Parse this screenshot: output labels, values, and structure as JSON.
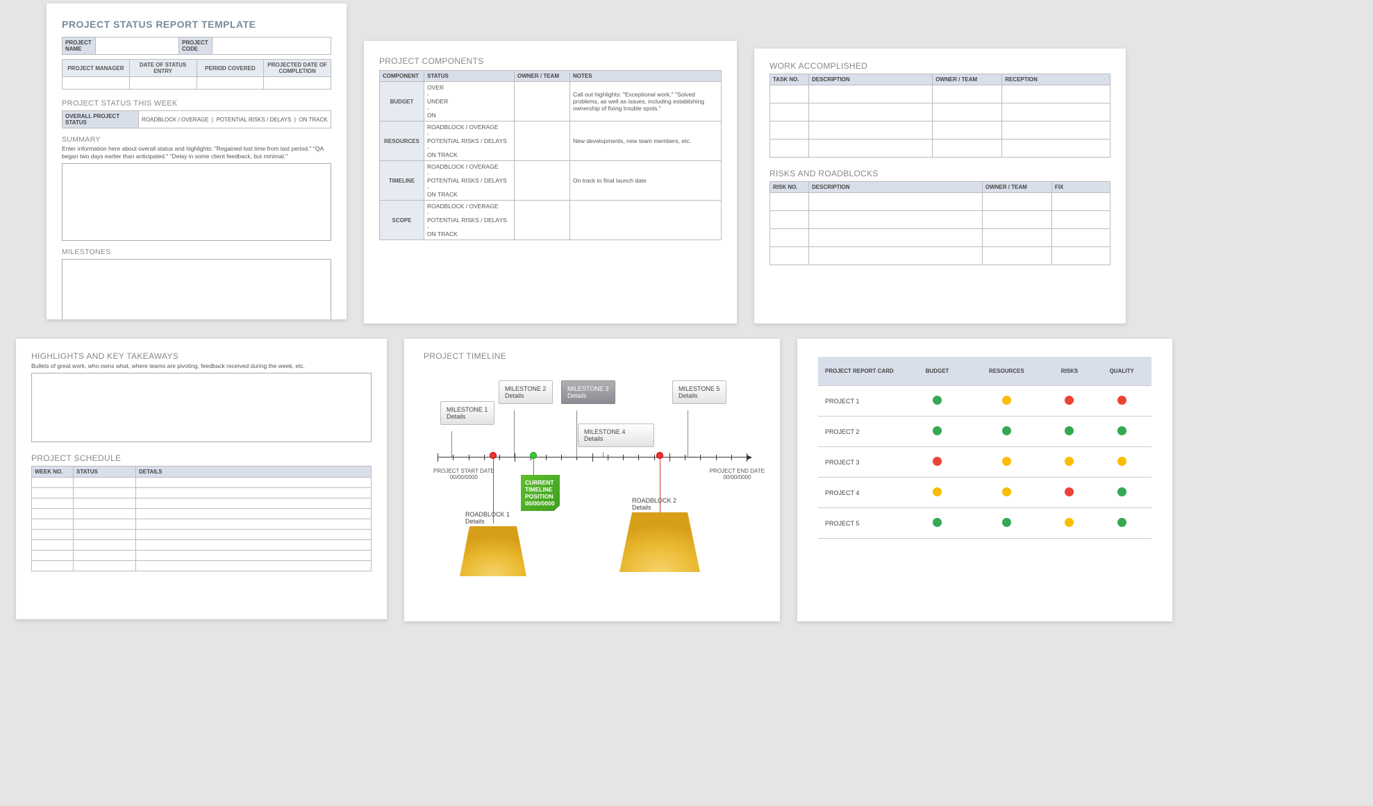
{
  "page1": {
    "title": "PROJECT STATUS REPORT TEMPLATE",
    "meta": {
      "project_name_label": "PROJECT NAME",
      "project_code_label": "PROJECT CODE",
      "pm_label": "PROJECT MANAGER",
      "entry_date_label": "DATE OF STATUS ENTRY",
      "period_label": "PERIOD COVERED",
      "projected_label": "PROJECTED DATE OF COMPLETION"
    },
    "status_week": "PROJECT STATUS THIS WEEK",
    "overall_lbl": "OVERALL PROJECT STATUS",
    "legend": [
      "ROADBLOCK / OVERAGE",
      "POTENTIAL RISKS / DELAYS",
      "ON TRACK"
    ],
    "summary": "SUMMARY",
    "summary_help": "Enter information here about overall status and highlights: \"Regained lost time from last period.\" \"QA began two days earlier than anticipated.\" \"Delay in some client feedback, but minimal.\"",
    "milestones": "MILESTONES"
  },
  "page2": {
    "title": "PROJECT COMPONENTS",
    "cols": [
      "COMPONENT",
      "STATUS",
      "OWNER / TEAM",
      "NOTES"
    ],
    "rows": [
      {
        "c": "BUDGET",
        "s": "OVER\n-\nUNDER\n-\nON",
        "n": "Call out highlights: \"Exceptional work,\" \"Solved problems, as well as issues, including establishing ownership of fixing trouble spots.\""
      },
      {
        "c": "RESOURCES",
        "s": "ROADBLOCK / OVERAGE\n-\nPOTENTIAL RISKS / DELAYS\n-\nON TRACK",
        "n": "New developments, new team members, etc."
      },
      {
        "c": "TIMELINE",
        "s": "ROADBLOCK / OVERAGE\n-\nPOTENTIAL RISKS / DELAYS\n-\nON TRACK",
        "n": "On track to final launch date"
      },
      {
        "c": "SCOPE",
        "s": "ROADBLOCK / OVERAGE\n-\nPOTENTIAL RISKS / DELAYS\n-\nON TRACK",
        "n": ""
      }
    ]
  },
  "page3": {
    "work": {
      "title": "WORK ACCOMPLISHED",
      "cols": [
        "TASK NO.",
        "DESCRIPTION",
        "OWNER / TEAM",
        "RECEPTION"
      ]
    },
    "risks": {
      "title": "RISKS AND ROADBLOCKS",
      "cols": [
        "RISK NO.",
        "DESCRIPTION",
        "OWNER / TEAM",
        "FIX"
      ]
    }
  },
  "page4": {
    "highlights": "HIGHLIGHTS AND KEY TAKEAWAYS",
    "highlights_help": "Bullets of great work, who owns what, where teams are pivoting, feedback received during the week, etc.",
    "schedule": "PROJECT SCHEDULE",
    "sched_cols": [
      "WEEK NO.",
      "STATUS",
      "DETAILS"
    ]
  },
  "page5": {
    "title": "PROJECT TIMELINE",
    "start_lbl": "PROJECT START DATE",
    "end_lbl": "PROJECT END DATE",
    "date": "00/00/0000",
    "milestones": [
      {
        "name": "MILESTONE 1",
        "sub": "Details"
      },
      {
        "name": "MILESTONE 2",
        "sub": "Details"
      },
      {
        "name": "MILESTONE 3",
        "sub": "Details"
      },
      {
        "name": "MILESTONE 4",
        "sub": "Details"
      },
      {
        "name": "MILESTONE 5",
        "sub": "Details"
      }
    ],
    "roadblocks": [
      {
        "name": "ROADBLOCK 1",
        "sub": "Details"
      },
      {
        "name": "ROADBLOCK 2",
        "sub": "Details"
      }
    ],
    "current": "CURRENT TIMELINE POSITION"
  },
  "page6": {
    "cols": [
      "PROJECT REPORT CARD",
      "BUDGET",
      "RESOURCES",
      "RISKS",
      "QUALITY"
    ],
    "rows": [
      {
        "name": "PROJECT 1",
        "v": [
          "g",
          "y",
          "r",
          "r"
        ]
      },
      {
        "name": "PROJECT 2",
        "v": [
          "g",
          "g",
          "g",
          "g"
        ]
      },
      {
        "name": "PROJECT 3",
        "v": [
          "r",
          "y",
          "y",
          "y"
        ]
      },
      {
        "name": "PROJECT 4",
        "v": [
          "y",
          "y",
          "r",
          "g"
        ]
      },
      {
        "name": "PROJECT 5",
        "v": [
          "g",
          "g",
          "y",
          "g"
        ]
      }
    ]
  }
}
